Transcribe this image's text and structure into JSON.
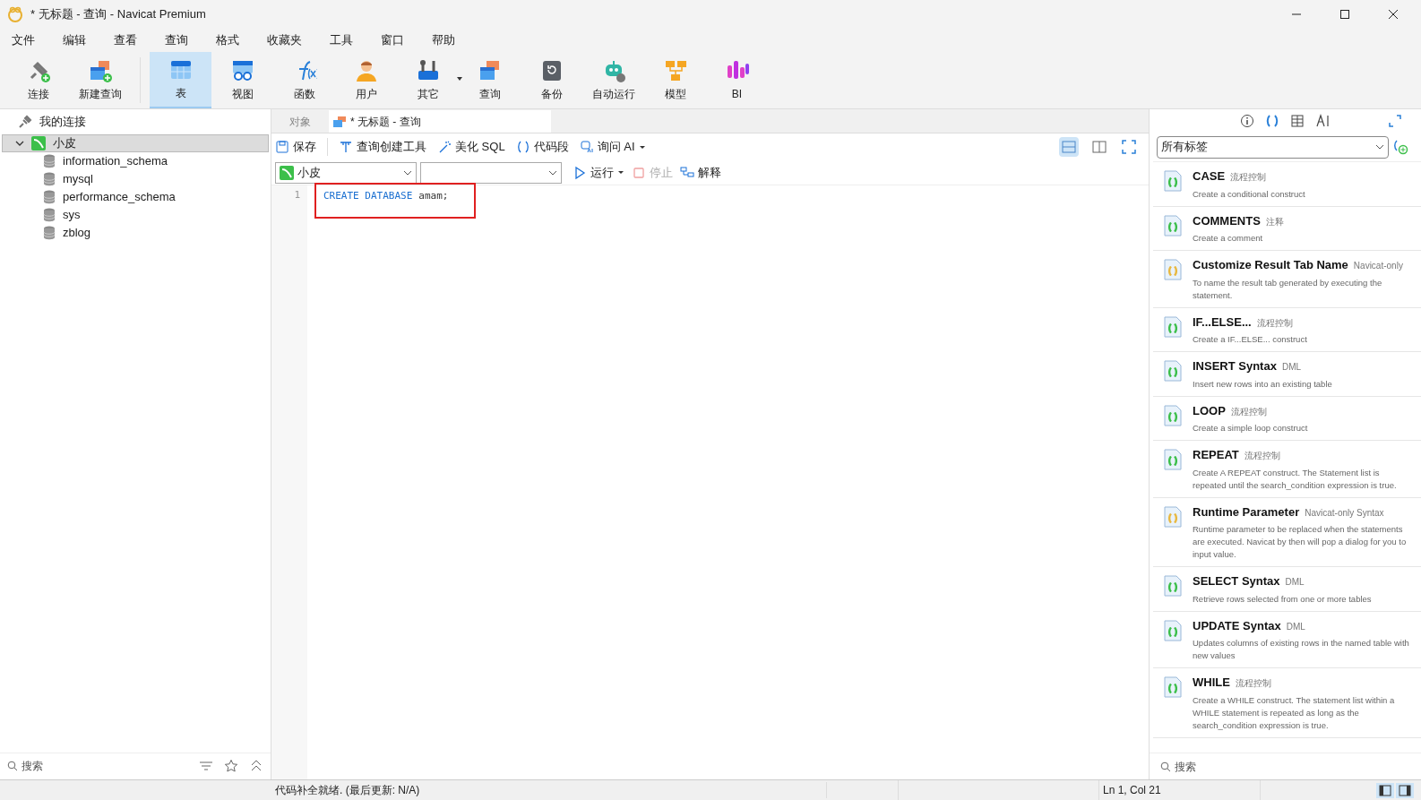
{
  "window": {
    "title": "* 无标题 - 查询 - Navicat Premium"
  },
  "menu": [
    "文件",
    "编辑",
    "查看",
    "查询",
    "格式",
    "收藏夹",
    "工具",
    "窗口",
    "帮助"
  ],
  "toolbar": [
    {
      "label": "连接",
      "selected": false,
      "dropdown": false
    },
    {
      "label": "新建查询",
      "selected": false,
      "dropdown": false
    },
    {
      "label": "表",
      "selected": true,
      "dropdown": false
    },
    {
      "label": "视图",
      "selected": false,
      "dropdown": false
    },
    {
      "label": "函数",
      "selected": false,
      "dropdown": false
    },
    {
      "label": "用户",
      "selected": false,
      "dropdown": false
    },
    {
      "label": "其它",
      "selected": false,
      "dropdown": true
    },
    {
      "label": "查询",
      "selected": false,
      "dropdown": false
    },
    {
      "label": "备份",
      "selected": false,
      "dropdown": false
    },
    {
      "label": "自动运行",
      "selected": false,
      "dropdown": false
    },
    {
      "label": "模型",
      "selected": false,
      "dropdown": false
    },
    {
      "label": "BI",
      "selected": false,
      "dropdown": false
    }
  ],
  "sidebar": {
    "header": "我的连接",
    "tree": [
      {
        "label": "小皮",
        "selected": true,
        "expanded": true,
        "children": [
          {
            "label": "information_schema"
          },
          {
            "label": "mysql"
          },
          {
            "label": "performance_schema"
          },
          {
            "label": "sys"
          },
          {
            "label": "zblog"
          }
        ]
      }
    ],
    "search_placeholder": "搜索"
  },
  "tabs": [
    {
      "label": "对象",
      "selected": false
    },
    {
      "label": "* 无标题 - 查询",
      "selected": true
    }
  ],
  "editor_toolbar": [
    "保存",
    "查询创建工具",
    "美化 SQL",
    "代码段",
    "询问 AI"
  ],
  "connection_select": "小皮",
  "run_toolbar": [
    {
      "label": "运行",
      "disabled": false
    },
    {
      "label": "停止",
      "disabled": true
    },
    {
      "label": "解释",
      "disabled": false
    }
  ],
  "editor": {
    "lines": [
      {
        "number": "1",
        "keywords": "CREATE DATABASE",
        "rest": "amam;"
      }
    ],
    "highlight_box": true
  },
  "snippets": {
    "filter": "所有标签",
    "items": [
      {
        "title": "CASE",
        "tag": "流程控制",
        "description": "Create a conditional construct",
        "color": "#3cbf4a"
      },
      {
        "title": "COMMENTS",
        "tag": "注释",
        "description": "Create a comment",
        "color": "#3cbf4a"
      },
      {
        "title": "Customize Result Tab Name",
        "tag": "Navicat-only",
        "description": "To name the result tab generated by executing the statement.",
        "color": "#e8b840"
      },
      {
        "title": "IF...ELSE...",
        "tag": "流程控制",
        "description": "Create a IF...ELSE... construct",
        "color": "#3cbf4a"
      },
      {
        "title": "INSERT Syntax",
        "tag": "DML",
        "description": "Insert new rows into an existing table",
        "color": "#3cbf4a"
      },
      {
        "title": "LOOP",
        "tag": "流程控制",
        "description": "Create a simple loop construct",
        "color": "#3cbf4a"
      },
      {
        "title": "REPEAT",
        "tag": "流程控制",
        "description": "Create A REPEAT construct. The Statement list is repeated until the search_condition expression is true.",
        "color": "#3cbf4a"
      },
      {
        "title": "Runtime Parameter",
        "tag": "Navicat-only Syntax",
        "description": "Runtime parameter to be replaced when the statements are executed. Navicat by then will pop a dialog for you to input value.",
        "color": "#e8b840"
      },
      {
        "title": "SELECT Syntax",
        "tag": "DML",
        "description": "Retrieve rows selected from one or more tables",
        "color": "#3cbf4a"
      },
      {
        "title": "UPDATE Syntax",
        "tag": "DML",
        "description": "Updates columns of existing rows in the named table with new values",
        "color": "#3cbf4a"
      },
      {
        "title": "WHILE",
        "tag": "流程控制",
        "description": "Create a WHILE construct. The statement list within a WHILE statement is repeated as long as the search_condition expression is true.",
        "color": "#3cbf4a"
      }
    ],
    "search_placeholder": "搜索"
  },
  "status_bar": {
    "message": "代码补全就绪. (最后更新: N/A)",
    "position": "Ln 1, Col 21"
  }
}
